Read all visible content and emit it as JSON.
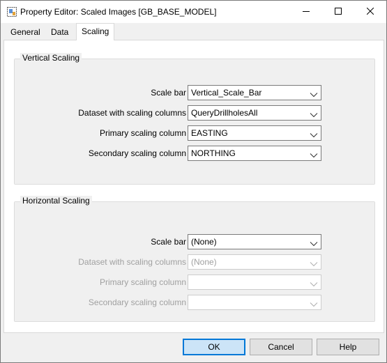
{
  "window": {
    "title": "Property Editor: Scaled Images [GB_BASE_MODEL]",
    "icon": "property-editor-icon",
    "controls": [
      "minimize-icon",
      "maximize-icon",
      "close-icon"
    ]
  },
  "tabs": [
    {
      "label": "General",
      "selected": false
    },
    {
      "label": "Data",
      "selected": false
    },
    {
      "label": "Scaling",
      "selected": true
    }
  ],
  "vertical": {
    "title": "Vertical Scaling",
    "rows": [
      {
        "label": "Scale bar",
        "value": "Vertical_Scale_Bar",
        "enabled": true
      },
      {
        "label": "Dataset with scaling columns",
        "value": "QueryDrillholesAll",
        "enabled": true
      },
      {
        "label": "Primary scaling column",
        "value": "EASTING",
        "enabled": true
      },
      {
        "label": "Secondary scaling column",
        "value": "NORTHING",
        "enabled": true
      }
    ]
  },
  "horizontal": {
    "title": "Horizontal Scaling",
    "rows": [
      {
        "label": "Scale bar",
        "value": "(None)",
        "enabled": true
      },
      {
        "label": "Dataset with scaling columns",
        "value": "(None)",
        "enabled": false
      },
      {
        "label": "Primary scaling column",
        "value": "",
        "enabled": false
      },
      {
        "label": "Secondary scaling column",
        "value": "",
        "enabled": false
      }
    ]
  },
  "buttons": {
    "ok": "OK",
    "cancel": "Cancel",
    "help": "Help"
  },
  "colors": {
    "focus_border": "#0078d7",
    "ok_fill": "#cce4f7",
    "disabled_text": "#a0a0a0"
  }
}
